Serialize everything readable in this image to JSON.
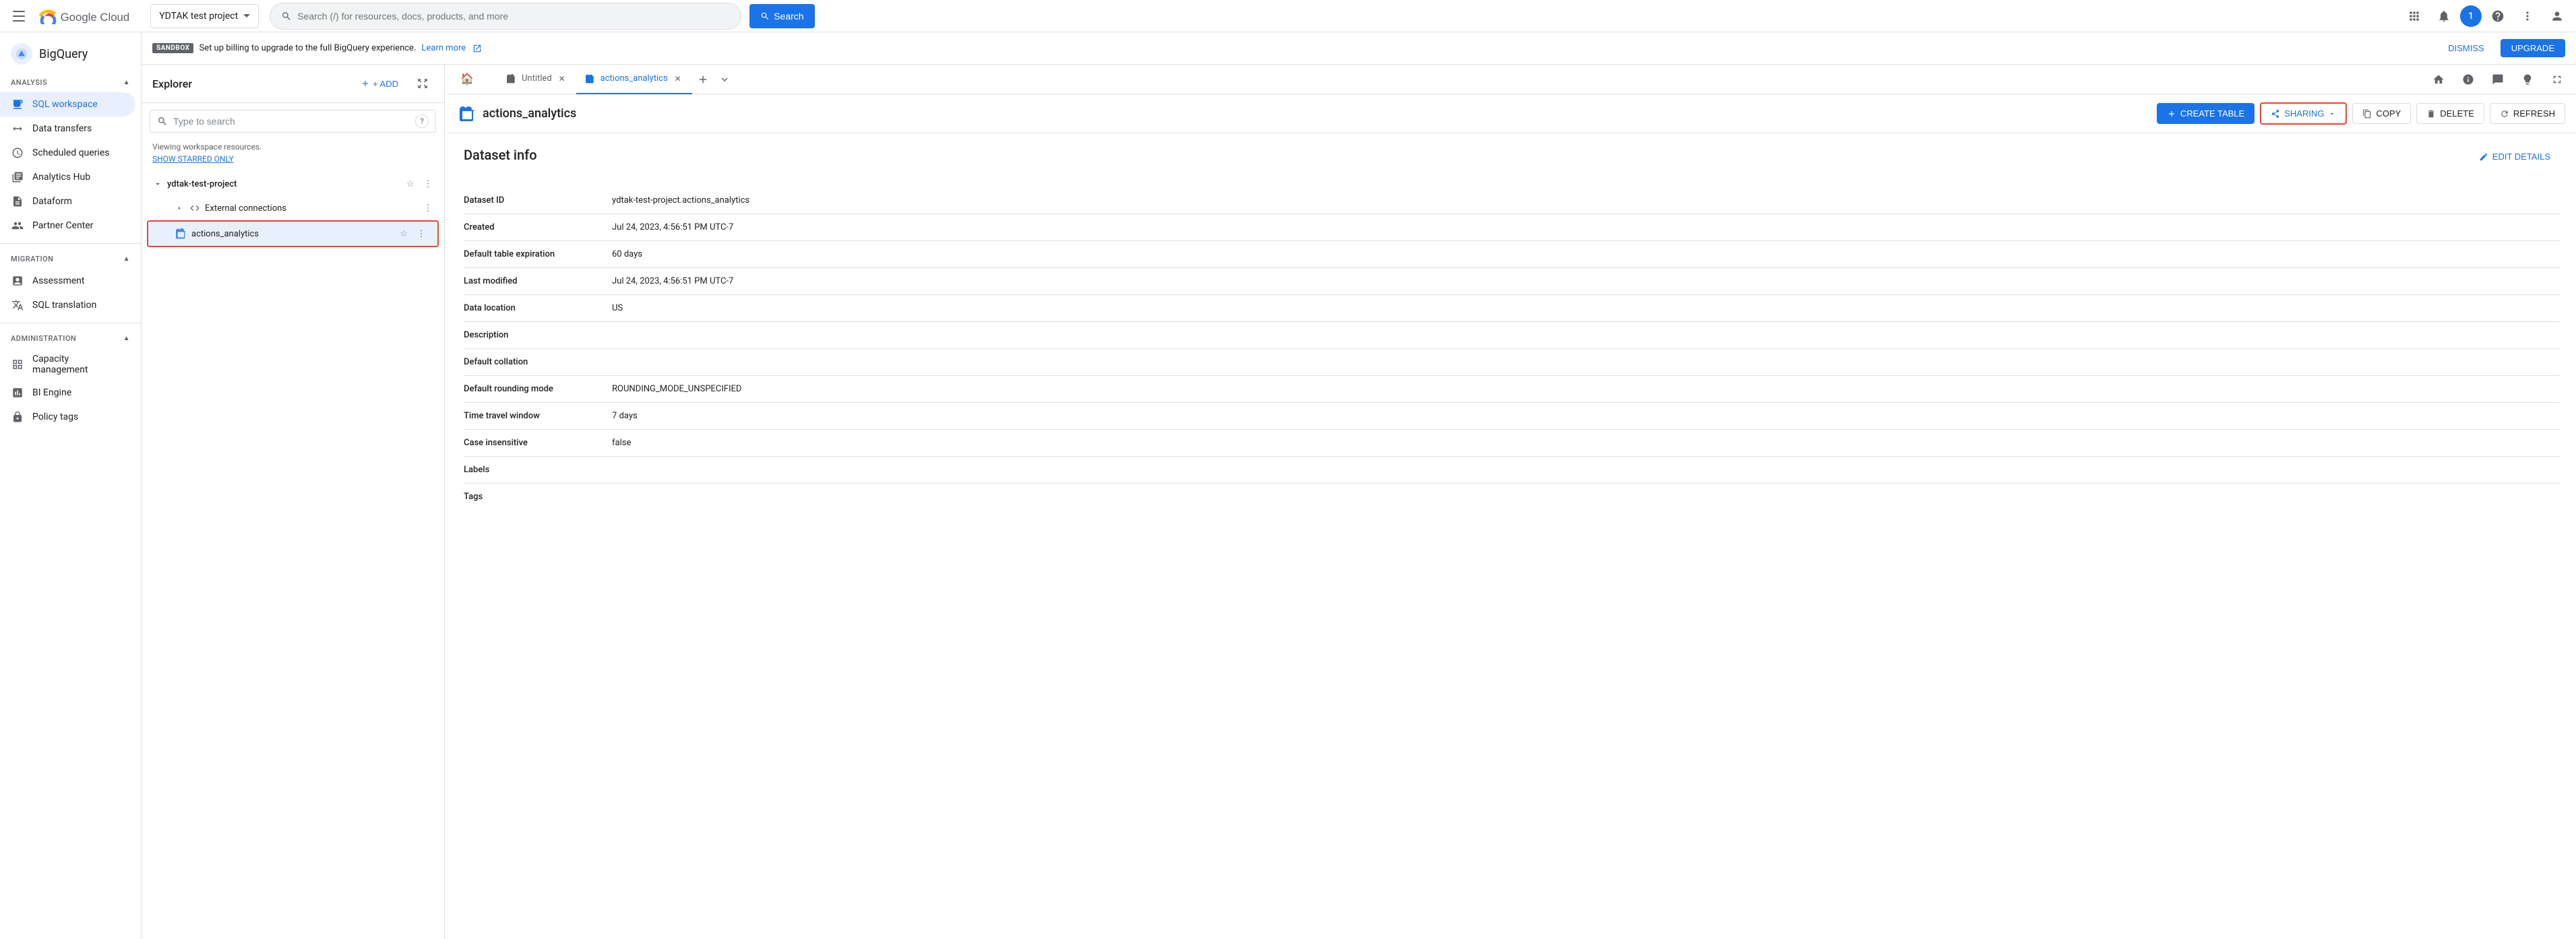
{
  "topnav": {
    "project_name": "YDTAK test project",
    "search_placeholder": "Search (/) for resources, docs, products, and more",
    "search_label": "Search",
    "avatar_label": "1"
  },
  "sidebar": {
    "bq_label": "BigQuery",
    "analysis_section": "Analysis",
    "items_analysis": [
      {
        "id": "sql-workspace",
        "label": "SQL workspace",
        "active": true
      },
      {
        "id": "data-transfers",
        "label": "Data transfers"
      },
      {
        "id": "scheduled-queries",
        "label": "Scheduled queries"
      },
      {
        "id": "analytics-hub",
        "label": "Analytics Hub"
      },
      {
        "id": "dataform",
        "label": "Dataform"
      },
      {
        "id": "partner-center",
        "label": "Partner Center"
      }
    ],
    "migration_section": "Migration",
    "items_migration": [
      {
        "id": "assessment",
        "label": "Assessment"
      },
      {
        "id": "sql-translation",
        "label": "SQL translation"
      }
    ],
    "administration_section": "Administration",
    "items_administration": [
      {
        "id": "capacity-management",
        "label": "Capacity management"
      },
      {
        "id": "bi-engine",
        "label": "BI Engine"
      },
      {
        "id": "policy-tags",
        "label": "Policy tags"
      }
    ]
  },
  "sandbox": {
    "badge": "SANDBOX",
    "message": "Set up billing to upgrade to the full BigQuery experience.",
    "learn_more": "Learn more",
    "dismiss": "DISMISS",
    "upgrade": "UPGRADE"
  },
  "explorer": {
    "title": "Explorer",
    "add_label": "+ ADD",
    "search_placeholder": "Type to search",
    "viewing_text": "Viewing workspace resources.",
    "show_starred": "SHOW STARRED ONLY",
    "project_name": "ydtak-test-project",
    "items": [
      {
        "id": "external-connections",
        "label": "External connections",
        "type": "connection"
      },
      {
        "id": "actions-analytics",
        "label": "actions_analytics",
        "type": "dataset",
        "selected": true
      }
    ]
  },
  "tabs": [
    {
      "id": "home",
      "label": "",
      "type": "home",
      "closeable": false
    },
    {
      "id": "untitled",
      "label": "Untitled",
      "type": "query",
      "active": false,
      "closeable": true
    },
    {
      "id": "actions-analytics",
      "label": "actions_analytics",
      "type": "dataset",
      "active": true,
      "closeable": true
    }
  ],
  "dataset": {
    "name": "actions_analytics",
    "toolbar": {
      "create_table": "CREATE TABLE",
      "sharing": "SHARING",
      "copy": "COPY",
      "delete": "DELETE",
      "refresh": "REFRESH",
      "edit_details": "EDIT DETAILS"
    },
    "info_title": "Dataset info",
    "fields": [
      {
        "label": "Dataset ID",
        "value": "ydtak-test-project.actions_analytics"
      },
      {
        "label": "Created",
        "value": "Jul 24, 2023, 4:56:51 PM UTC-7"
      },
      {
        "label": "Default table expiration",
        "value": "60 days"
      },
      {
        "label": "Last modified",
        "value": "Jul 24, 2023, 4:56:51 PM UTC-7"
      },
      {
        "label": "Data location",
        "value": "US"
      },
      {
        "label": "Description",
        "value": ""
      },
      {
        "label": "Default collation",
        "value": ""
      },
      {
        "label": "Default rounding mode",
        "value": "ROUNDING_MODE_UNSPECIFIED"
      },
      {
        "label": "Time travel window",
        "value": "7 days"
      },
      {
        "label": "Case insensitive",
        "value": "false"
      },
      {
        "label": "Labels",
        "value": ""
      },
      {
        "label": "Tags",
        "value": ""
      }
    ]
  }
}
